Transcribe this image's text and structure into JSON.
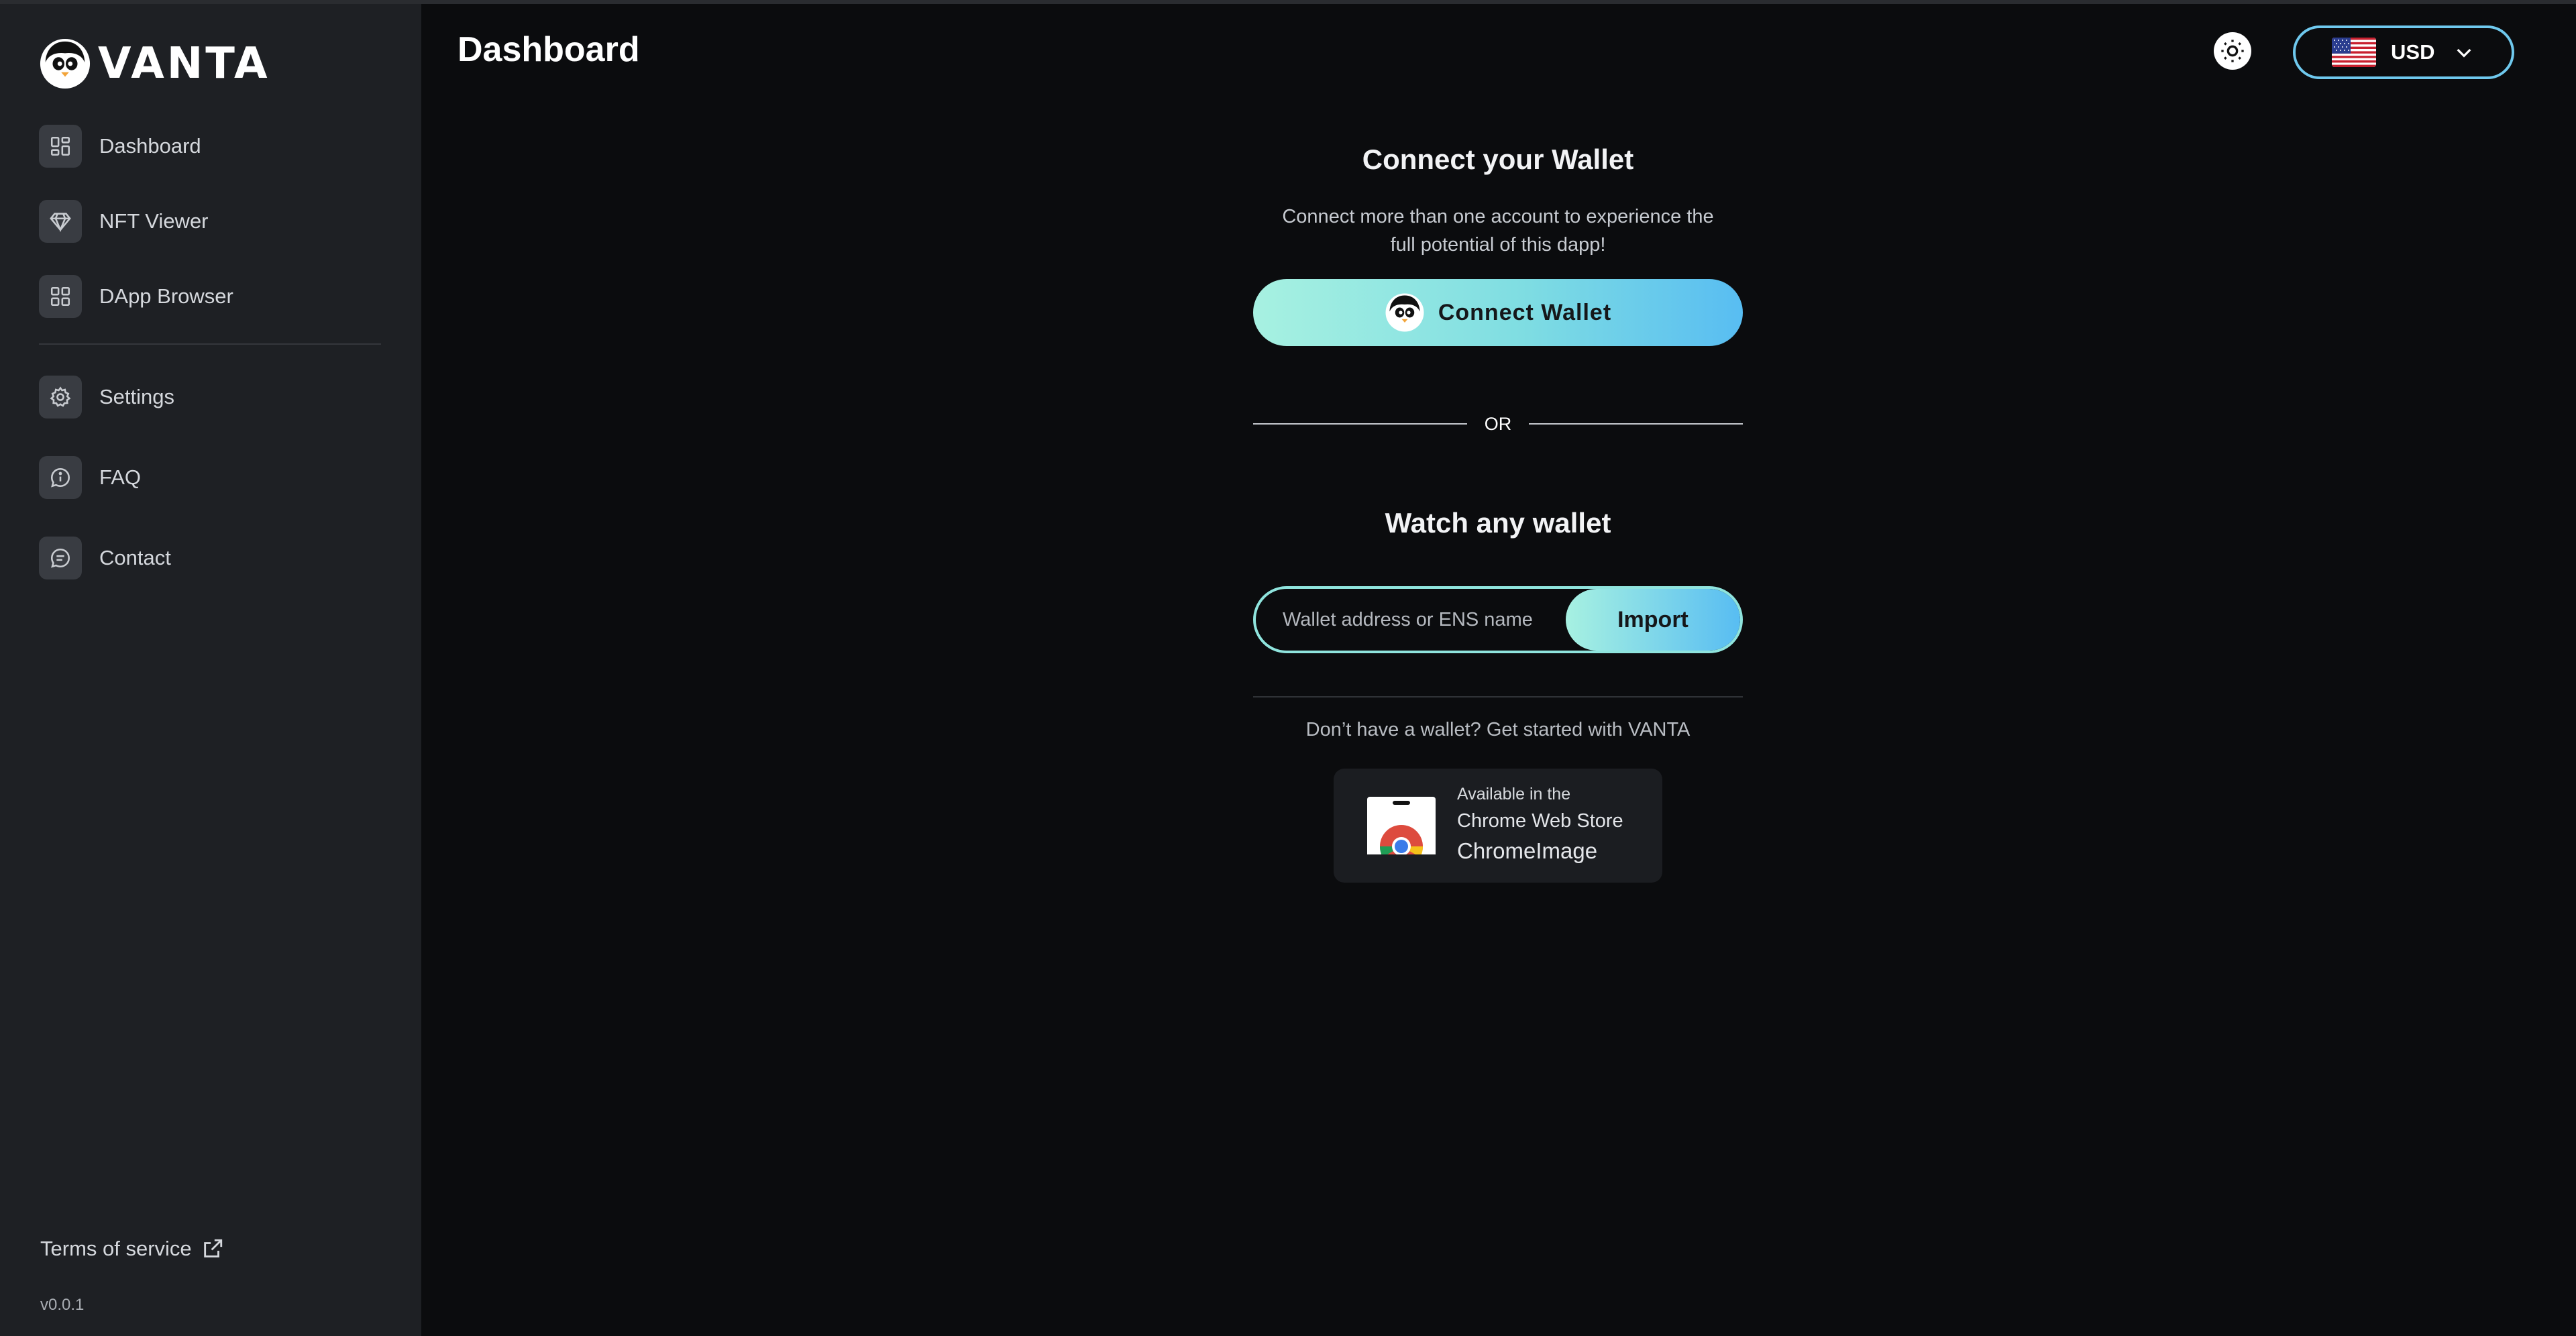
{
  "brand": {
    "name": "VANTA"
  },
  "sidebar": {
    "items": [
      {
        "label": "Dashboard",
        "icon": "grid-icon"
      },
      {
        "label": "NFT Viewer",
        "icon": "diamond-icon"
      },
      {
        "label": "DApp Browser",
        "icon": "grid-icon"
      },
      {
        "label": "Settings",
        "icon": "gear-icon"
      },
      {
        "label": "FAQ",
        "icon": "info-icon"
      },
      {
        "label": "Contact",
        "icon": "chat-icon"
      }
    ],
    "terms_label": "Terms of service",
    "version": "v0.0.1"
  },
  "header": {
    "title": "Dashboard",
    "currency": "USD"
  },
  "connect": {
    "title": "Connect your Wallet",
    "subtitle_line1": "Connect more than one account to experience the",
    "subtitle_line2": "full potential of this dapp!",
    "button_label": "Connect Wallet",
    "or_label": "OR"
  },
  "watch": {
    "title": "Watch any wallet",
    "input_placeholder": "Wallet address or ENS name",
    "input_value": "",
    "import_label": "Import",
    "started_text": "Don’t have a wallet? Get started with VANTA"
  },
  "store": {
    "small": "Available in the",
    "line2": "Chrome Web Store",
    "line3": "ChromeImage"
  },
  "colors": {
    "accent_start": "#a7f1e1",
    "accent_end": "#58bdf2",
    "sidebar_bg": "#1e2024",
    "page_bg": "#0b0c0e"
  }
}
